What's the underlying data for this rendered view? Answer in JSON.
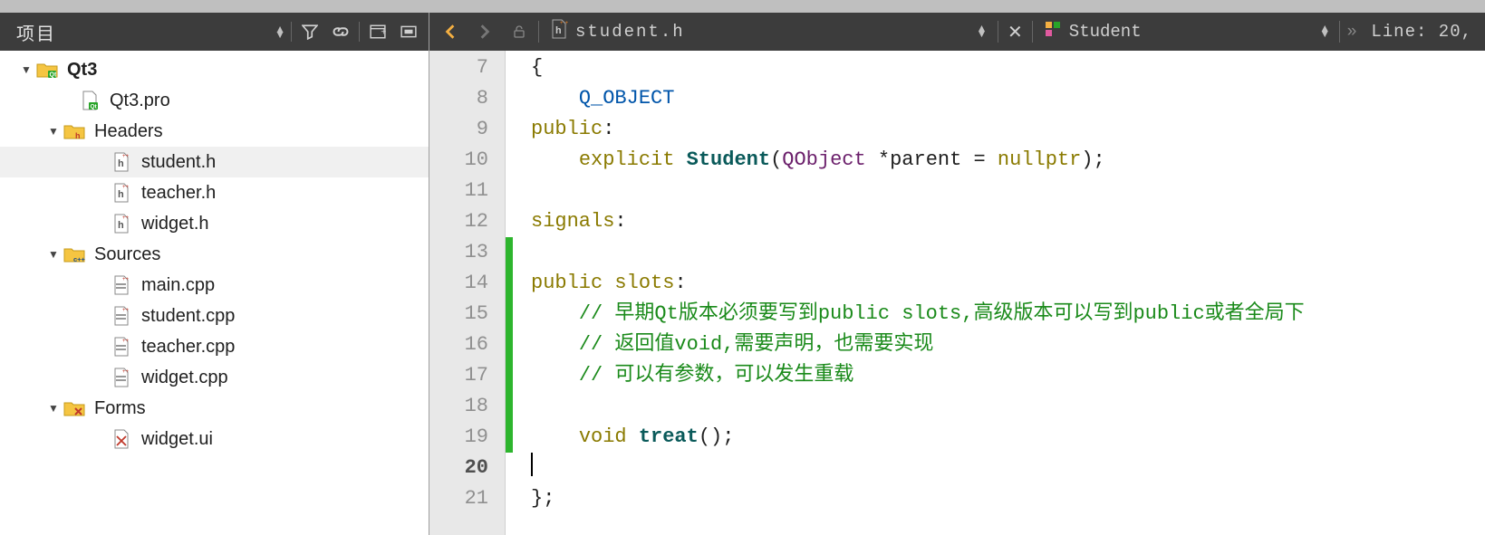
{
  "sidebar": {
    "title": "项目",
    "project": {
      "name": "Qt3",
      "profile": "Qt3.pro",
      "headers_label": "Headers",
      "headers": [
        "student.h",
        "teacher.h",
        "widget.h"
      ],
      "sources_label": "Sources",
      "sources": [
        "main.cpp",
        "student.cpp",
        "teacher.cpp",
        "widget.cpp"
      ],
      "forms_label": "Forms",
      "forms": [
        "widget.ui"
      ]
    }
  },
  "editor": {
    "filename": "student.h",
    "symbol": "Student",
    "line_info": "Line: 20,",
    "gutter_start": 7,
    "gutter_end": 21,
    "current_line": 20,
    "marker_green_lines": [
      13,
      14,
      15,
      16,
      17,
      18,
      19
    ],
    "code_lines": [
      {
        "n": 7,
        "raw": "{",
        "tokens": [
          {
            "t": "{",
            "c": "punct"
          }
        ]
      },
      {
        "n": 8,
        "raw": "    Q_OBJECT",
        "tokens": [
          {
            "t": "    ",
            "c": ""
          },
          {
            "t": "Q_OBJECT",
            "c": "kwblue"
          }
        ]
      },
      {
        "n": 9,
        "raw": "public:",
        "tokens": [
          {
            "t": "public",
            "c": "kw"
          },
          {
            "t": ":",
            "c": "punct"
          }
        ]
      },
      {
        "n": 10,
        "raw": "    explicit Student(QObject *parent = nullptr);",
        "tokens": [
          {
            "t": "    ",
            "c": ""
          },
          {
            "t": "explicit",
            "c": "kw"
          },
          {
            "t": " ",
            "c": ""
          },
          {
            "t": "Student",
            "c": "classname"
          },
          {
            "t": "(",
            "c": "punct"
          },
          {
            "t": "QObject",
            "c": "type"
          },
          {
            "t": " *parent = ",
            "c": ""
          },
          {
            "t": "nullptr",
            "c": "kw"
          },
          {
            "t": ");",
            "c": "punct"
          }
        ]
      },
      {
        "n": 11,
        "raw": "",
        "tokens": []
      },
      {
        "n": 12,
        "raw": "signals:",
        "tokens": [
          {
            "t": "signals",
            "c": "kw"
          },
          {
            "t": ":",
            "c": "punct"
          }
        ]
      },
      {
        "n": 13,
        "raw": "",
        "tokens": []
      },
      {
        "n": 14,
        "raw": "public slots:",
        "tokens": [
          {
            "t": "public",
            "c": "kw"
          },
          {
            "t": " ",
            "c": ""
          },
          {
            "t": "slots",
            "c": "kw"
          },
          {
            "t": ":",
            "c": "punct"
          }
        ]
      },
      {
        "n": 15,
        "raw": "    // 早期Qt版本必须要写到public slots,高级版本可以写到public或者全局下",
        "tokens": [
          {
            "t": "    ",
            "c": ""
          },
          {
            "t": "// 早期Qt版本必须要写到public slots,高级版本可以写到public或者全局下",
            "c": "comment"
          }
        ]
      },
      {
        "n": 16,
        "raw": "    // 返回值void,需要声明，也需要实现",
        "tokens": [
          {
            "t": "    ",
            "c": ""
          },
          {
            "t": "// 返回值void,需要声明，也需要实现",
            "c": "comment"
          }
        ]
      },
      {
        "n": 17,
        "raw": "    // 可以有参数，可以发生重载",
        "tokens": [
          {
            "t": "    ",
            "c": ""
          },
          {
            "t": "// 可以有参数，可以发生重载",
            "c": "comment"
          }
        ]
      },
      {
        "n": 18,
        "raw": "",
        "tokens": []
      },
      {
        "n": 19,
        "raw": "    void treat();",
        "tokens": [
          {
            "t": "    ",
            "c": ""
          },
          {
            "t": "void",
            "c": "kw"
          },
          {
            "t": " ",
            "c": ""
          },
          {
            "t": "treat",
            "c": "funcname"
          },
          {
            "t": "();",
            "c": "punct"
          }
        ]
      },
      {
        "n": 20,
        "raw": "",
        "tokens": [],
        "cursor": true
      },
      {
        "n": 21,
        "raw": "};",
        "tokens": [
          {
            "t": "};",
            "c": "punct"
          }
        ]
      }
    ]
  },
  "icons": {
    "folder_qt": "folder-qt-icon",
    "folder_h": "folder-h-icon",
    "folder_cpp": "folder-cpp-icon",
    "folder_form": "folder-form-icon",
    "file_pro": "file-pro-icon",
    "file_h": "file-h-icon",
    "file_cpp": "file-cpp-icon",
    "file_ui": "file-ui-icon"
  }
}
